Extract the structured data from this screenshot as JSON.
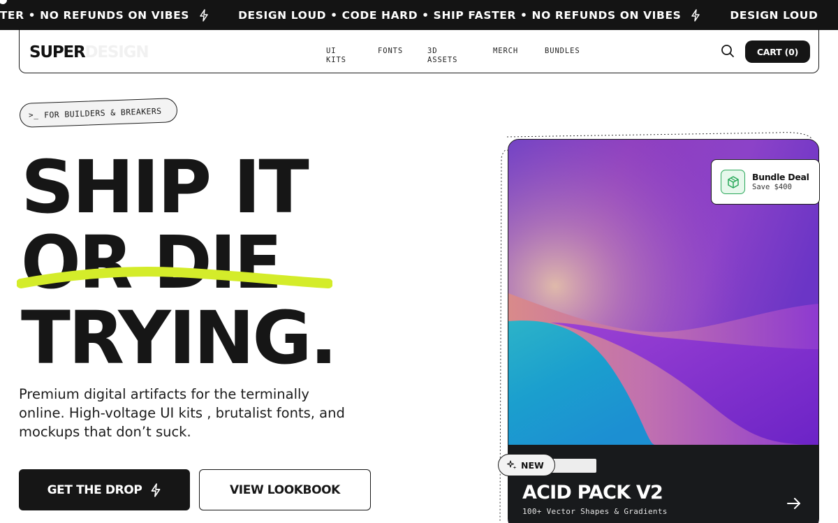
{
  "marquee": {
    "items": [
      "STER • NO REFUNDS ON VIBES",
      "DESIGN LOUD • CODE HARD • SHIP FASTER • NO REFUNDS ON VIBES",
      "DESIGN LOUD"
    ],
    "separator_icon": "bolt-icon"
  },
  "nav": {
    "logo_primary": "SUPER",
    "logo_secondary": "DESIGN",
    "links": [
      "UI\nKITS",
      "FONTS",
      "3D\nASSETS",
      "MERCH",
      "BUNDLES"
    ],
    "search_icon": "search-icon",
    "cart_label": "CART (0)"
  },
  "hero": {
    "badge_prompt": ">_",
    "badge_text": "FOR BUILDERS & BREAKERS",
    "headline": [
      "SHIP IT",
      "OR DIE",
      "TRYING."
    ],
    "highlight_color": "#d4ec2a",
    "description": "Premium digital artifacts for the terminally online. High-voltage UI kits , brutalist fonts, and mockups that don’t suck.",
    "primary_cta": "GET THE DROP",
    "secondary_cta": "VIEW LOOKBOOK"
  },
  "product": {
    "tag": "NEW",
    "title": "ACID PACK V2",
    "subtitle": "100+ Vector Shapes & Gradients",
    "arrow_icon": "arrow-right-icon",
    "bundle_title": "Bundle Deal",
    "bundle_subtitle": "Save $400",
    "bundle_icon": "box-icon",
    "bundle_color": "#2aa85a"
  }
}
